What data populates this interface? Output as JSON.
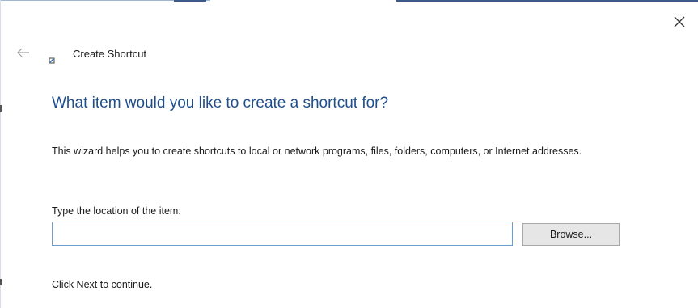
{
  "window": {
    "title": "Create Shortcut"
  },
  "icons": {
    "close": "close-icon",
    "back": "back-arrow-icon",
    "app": "shortcut-icon"
  },
  "colors": {
    "heading": "#1f4e8c",
    "input_border": "#6c9fcf",
    "button_bg": "#e6e6e6"
  },
  "content": {
    "heading": "What item would you like to create a shortcut for?",
    "description": "This wizard helps you to create shortcuts to local or network programs, files, folders, computers, or Internet addresses.",
    "location_label": "Type the location of the item:",
    "location_value": "",
    "location_placeholder": "",
    "browse_label": "Browse...",
    "footer": "Click Next to continue."
  }
}
